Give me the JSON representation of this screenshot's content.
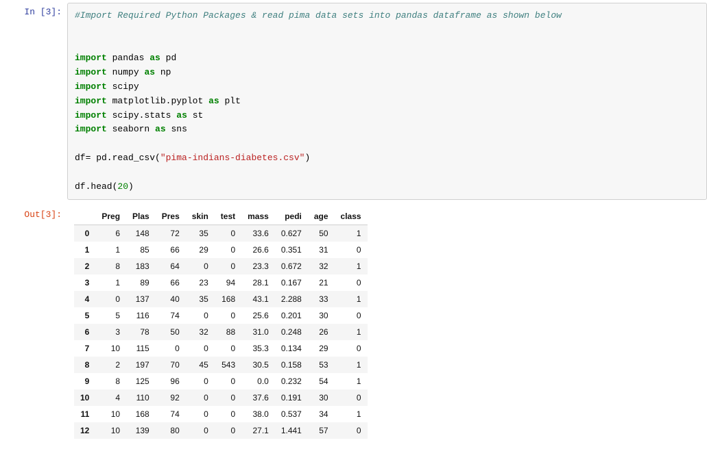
{
  "cell": {
    "in_prompt": "In [3]:",
    "out_prompt": "Out[3]:",
    "code": {
      "comment": "#Import Required Python Packages & read pima data sets into pandas dataframe as shown below",
      "kw_import": "import",
      "kw_as": "as",
      "mod_pandas": "pandas",
      "alias_pd": "pd",
      "mod_numpy": "numpy",
      "alias_np": "np",
      "mod_scipy": "scipy",
      "mod_mpl": "matplotlib.pyplot",
      "alias_plt": "plt",
      "mod_scipy_stats": "scipy.stats",
      "alias_st": "st",
      "mod_seaborn": "seaborn",
      "alias_sns": "sns",
      "df_assign": "df= pd.read_csv(",
      "csv_path": "\"pima-indians-diabetes.csv\"",
      "close_paren": ")",
      "head_call_prefix": "df.head(",
      "head_n": "20",
      "head_call_suffix": ")"
    }
  },
  "table": {
    "columns": [
      "Preg",
      "Plas",
      "Pres",
      "skin",
      "test",
      "mass",
      "pedi",
      "age",
      "class"
    ],
    "rows": [
      {
        "idx": "0",
        "vals": [
          "6",
          "148",
          "72",
          "35",
          "0",
          "33.6",
          "0.627",
          "50",
          "1"
        ]
      },
      {
        "idx": "1",
        "vals": [
          "1",
          "85",
          "66",
          "29",
          "0",
          "26.6",
          "0.351",
          "31",
          "0"
        ]
      },
      {
        "idx": "2",
        "vals": [
          "8",
          "183",
          "64",
          "0",
          "0",
          "23.3",
          "0.672",
          "32",
          "1"
        ]
      },
      {
        "idx": "3",
        "vals": [
          "1",
          "89",
          "66",
          "23",
          "94",
          "28.1",
          "0.167",
          "21",
          "0"
        ]
      },
      {
        "idx": "4",
        "vals": [
          "0",
          "137",
          "40",
          "35",
          "168",
          "43.1",
          "2.288",
          "33",
          "1"
        ]
      },
      {
        "idx": "5",
        "vals": [
          "5",
          "116",
          "74",
          "0",
          "0",
          "25.6",
          "0.201",
          "30",
          "0"
        ]
      },
      {
        "idx": "6",
        "vals": [
          "3",
          "78",
          "50",
          "32",
          "88",
          "31.0",
          "0.248",
          "26",
          "1"
        ]
      },
      {
        "idx": "7",
        "vals": [
          "10",
          "115",
          "0",
          "0",
          "0",
          "35.3",
          "0.134",
          "29",
          "0"
        ]
      },
      {
        "idx": "8",
        "vals": [
          "2",
          "197",
          "70",
          "45",
          "543",
          "30.5",
          "0.158",
          "53",
          "1"
        ]
      },
      {
        "idx": "9",
        "vals": [
          "8",
          "125",
          "96",
          "0",
          "0",
          "0.0",
          "0.232",
          "54",
          "1"
        ]
      },
      {
        "idx": "10",
        "vals": [
          "4",
          "110",
          "92",
          "0",
          "0",
          "37.6",
          "0.191",
          "30",
          "0"
        ]
      },
      {
        "idx": "11",
        "vals": [
          "10",
          "168",
          "74",
          "0",
          "0",
          "38.0",
          "0.537",
          "34",
          "1"
        ]
      },
      {
        "idx": "12",
        "vals": [
          "10",
          "139",
          "80",
          "0",
          "0",
          "27.1",
          "1.441",
          "57",
          "0"
        ]
      }
    ]
  }
}
